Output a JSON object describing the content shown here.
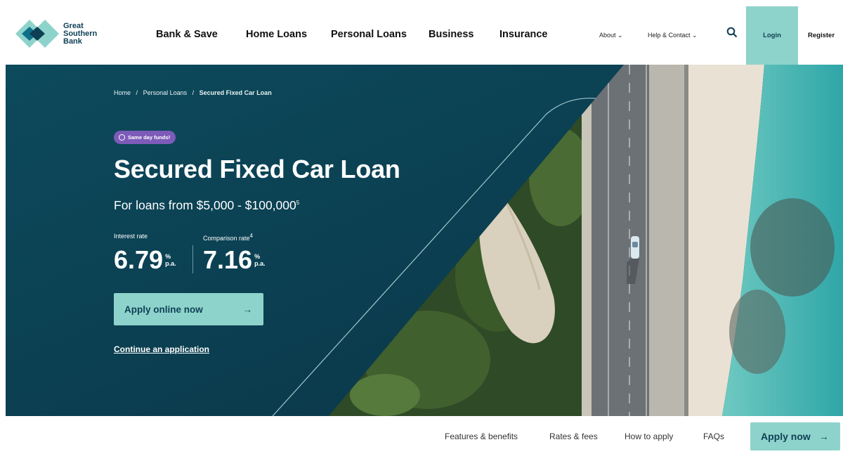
{
  "brand": {
    "name_lines": [
      "Great",
      "Southern",
      "Bank"
    ]
  },
  "nav": {
    "items": [
      "Bank & Save",
      "Home Loans",
      "Personal Loans",
      "Business",
      "Insurance"
    ]
  },
  "utility": {
    "about": "About",
    "help": "Help & Contact",
    "login": "Login",
    "register": "Register"
  },
  "breadcrumb": {
    "home": "Home",
    "section": "Personal Loans",
    "current": "Secured Fixed Car Loan",
    "sep": "/"
  },
  "hero": {
    "badge": "Same day funds",
    "badge_note": "2",
    "title": "Secured Fixed Car Loan",
    "subtitle": "For loans from $5,000 - $100,000",
    "subtitle_note": "5",
    "interest": {
      "label": "Interest rate",
      "value": "6.79",
      "unit_top": "%",
      "unit_bottom": "p.a."
    },
    "comparison": {
      "label": "Comparison rate",
      "note": "4",
      "value": "7.16",
      "unit_top": "%",
      "unit_bottom": "p.a."
    },
    "apply_label": "Apply online now",
    "continue_label": "Continue an application"
  },
  "subnav": {
    "items": [
      "Features & benefits",
      "Rates & fees",
      "How to apply",
      "FAQs"
    ],
    "apply_label": "Apply now"
  },
  "colors": {
    "navy": "#0c3f52",
    "mint": "#8ed3cb",
    "badge_purple": "#7d5bb8"
  }
}
